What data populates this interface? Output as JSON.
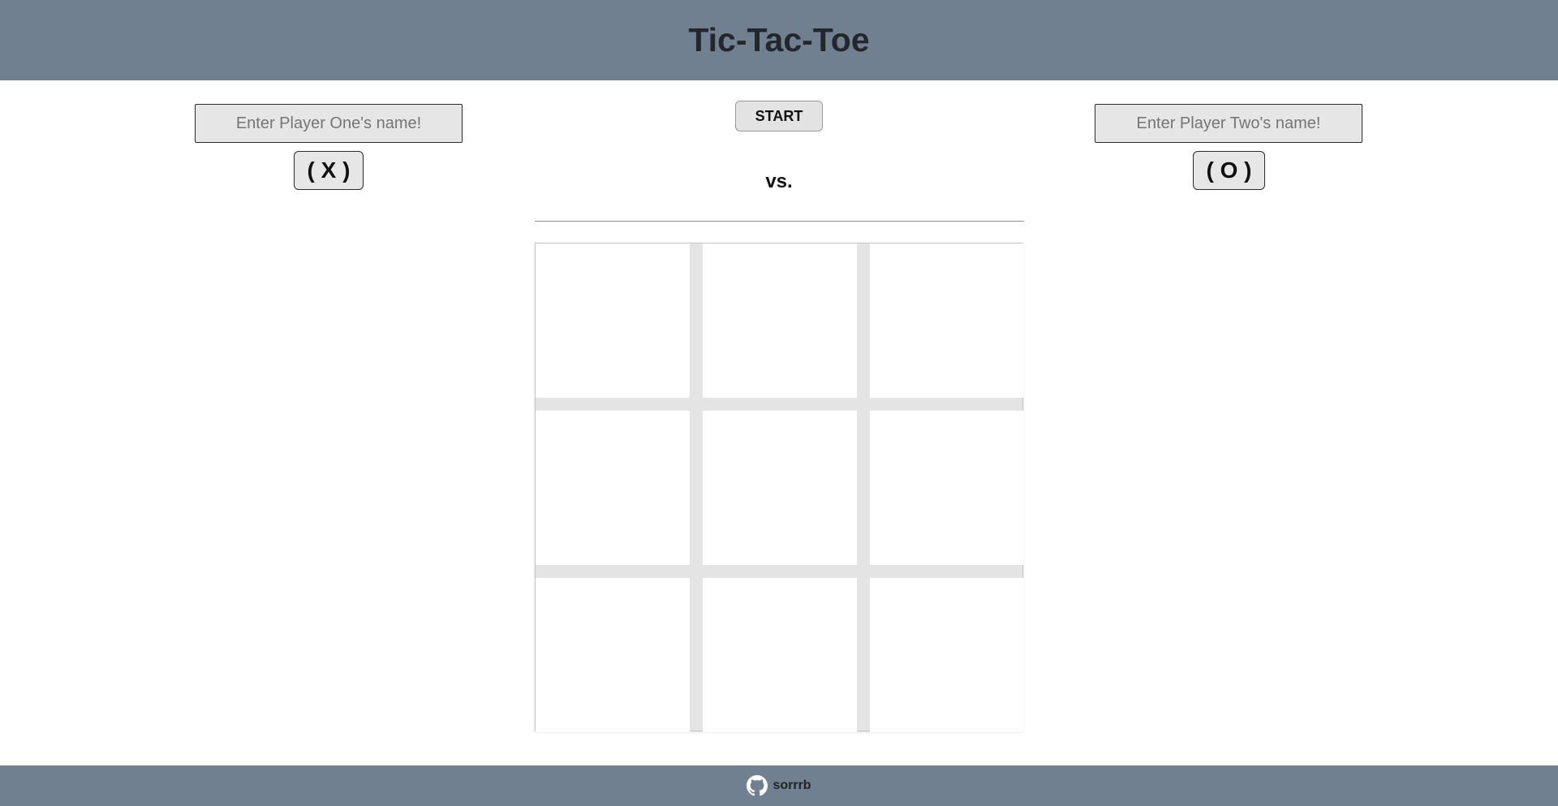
{
  "header": {
    "title": "Tic-Tac-Toe"
  },
  "player_one": {
    "name_value": "",
    "name_placeholder": "Enter Player One's name!",
    "mark_label": "( X )"
  },
  "player_two": {
    "name_value": "",
    "name_placeholder": "Enter Player Two's name!",
    "mark_label": "( O )"
  },
  "controls": {
    "start_label": "START",
    "vs_label": "vs."
  },
  "board": {
    "cells": [
      "",
      "",
      "",
      "",
      "",
      "",
      "",
      "",
      ""
    ]
  },
  "footer": {
    "github_user": "sorrrb",
    "icon": "github-icon"
  },
  "colors": {
    "header_bg": "#708090",
    "footer_bg": "#708090",
    "board_grid": "#e4e4e4"
  }
}
